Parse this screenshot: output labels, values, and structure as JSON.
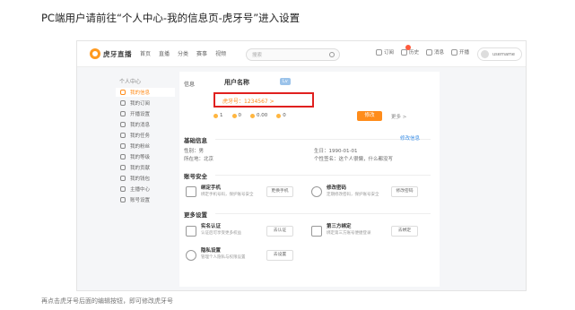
{
  "instruction": "PC端用户请前往“个人中心-我的信息页-虎牙号”进入设置",
  "nav": {
    "logo": "虎牙直播",
    "items": [
      "首页",
      "直播",
      "分类",
      "赛事",
      "视频"
    ],
    "search_placeholder": "搜索",
    "right_items": [
      "订阅",
      "历史",
      "消息",
      "开播"
    ],
    "user_name": "username"
  },
  "sidebar": {
    "title": "个人中心",
    "items": [
      "我的信息",
      "我的订阅",
      "开播设置",
      "我的消息",
      "我的任务",
      "我的粉丝",
      "我的等级",
      "我的贡献",
      "我的钱包",
      "主播中心",
      "账号设置"
    ],
    "active_index": 0
  },
  "card": {
    "tab_label": "信息",
    "username": "用户名称",
    "tag": "Lv",
    "huya_id": "虎牙号：1234567 >",
    "stats": [
      {
        "label": "1"
      },
      {
        "label": "0"
      },
      {
        "label": "0.00"
      },
      {
        "label": "0"
      }
    ],
    "edit_button": "修改",
    "more_link": "更多 >"
  },
  "basic": {
    "title": "基础信息",
    "link": "修改信息",
    "rows": [
      {
        "label": "性别：男",
        "value": "生日：1990-01-01"
      },
      {
        "label": "所在地：北京",
        "value": "个性签名：这个人很懒，什么都没写"
      }
    ]
  },
  "security": {
    "title": "账号安全",
    "tiles": [
      {
        "title": "绑定手机",
        "desc": "绑定手机号码，保护账号安全",
        "button": "更换手机"
      },
      {
        "title": "修改密码",
        "desc": "定期修改密码，保护账号安全",
        "button": "修改密码"
      }
    ]
  },
  "more": {
    "title": "更多设置",
    "tiles": [
      {
        "title": "实名认证",
        "desc": "认证后可享受更多权益",
        "button": "去认证"
      },
      {
        "title": "第三方绑定",
        "desc": "绑定第三方账号便捷登录",
        "button": "去绑定"
      },
      {
        "title": "隐私设置",
        "desc": "管理个人隐私与权限设置",
        "button": "去设置"
      }
    ]
  },
  "footer_text": "再点击虎牙号后面的编辑按钮，即可修改虎牙号"
}
